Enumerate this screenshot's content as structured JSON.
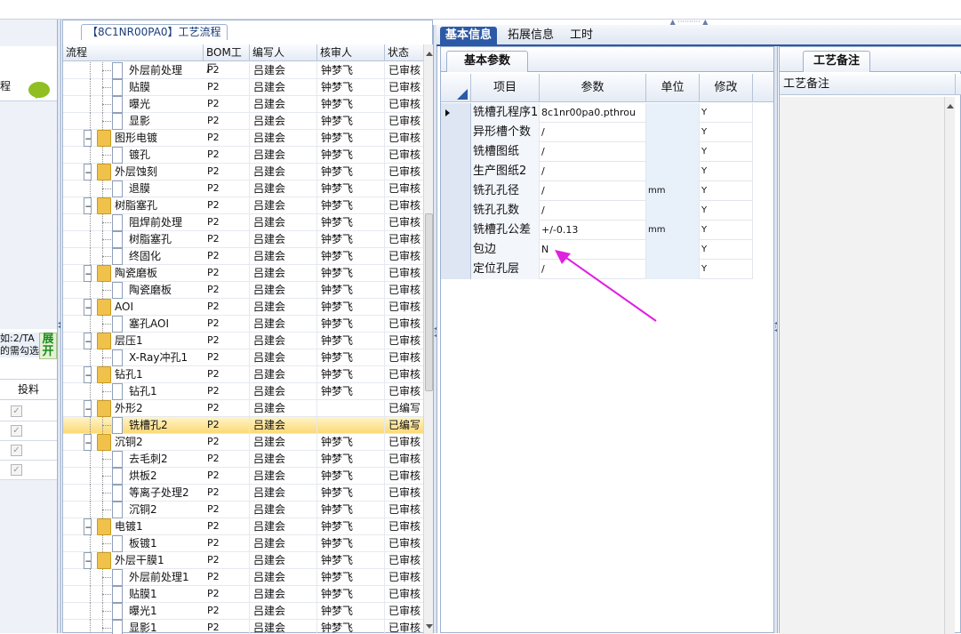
{
  "left_panel": {
    "title_fragment": "程",
    "hint_text": "如:2/TA 的需勾选",
    "expand_label": "展开",
    "column_label": "投料",
    "checked_rows": [
      "✓",
      "✓",
      "✓",
      "✓"
    ]
  },
  "flow_panel": {
    "caption": "【8C1NR00PA0】工艺流程",
    "columns": [
      "流程",
      "BOM工厂",
      "编写人",
      "核审人",
      "状态"
    ],
    "rows": [
      {
        "name": "外层前处理",
        "level": 2,
        "bom": "P2",
        "writer": "吕建会",
        "reviewer": "钟梦飞",
        "status": "已审核"
      },
      {
        "name": "贴膜",
        "level": 2,
        "bom": "P2",
        "writer": "吕建会",
        "reviewer": "钟梦飞",
        "status": "已审核"
      },
      {
        "name": "曝光",
        "level": 2,
        "bom": "P2",
        "writer": "吕建会",
        "reviewer": "钟梦飞",
        "status": "已审核"
      },
      {
        "name": "显影",
        "level": 2,
        "bom": "P2",
        "writer": "吕建会",
        "reviewer": "钟梦飞",
        "status": "已审核"
      },
      {
        "name": "图形电镀",
        "level": 1,
        "bom": "P2",
        "writer": "吕建会",
        "reviewer": "钟梦飞",
        "status": "已审核"
      },
      {
        "name": "镀孔",
        "level": 2,
        "bom": "P2",
        "writer": "吕建会",
        "reviewer": "钟梦飞",
        "status": "已审核"
      },
      {
        "name": "外层蚀刻",
        "level": 1,
        "bom": "P2",
        "writer": "吕建会",
        "reviewer": "钟梦飞",
        "status": "已审核"
      },
      {
        "name": "退膜",
        "level": 2,
        "bom": "P2",
        "writer": "吕建会",
        "reviewer": "钟梦飞",
        "status": "已审核"
      },
      {
        "name": "树脂塞孔",
        "level": 1,
        "bom": "P2",
        "writer": "吕建会",
        "reviewer": "钟梦飞",
        "status": "已审核"
      },
      {
        "name": "阻焊前处理",
        "level": 2,
        "bom": "P2",
        "writer": "吕建会",
        "reviewer": "钟梦飞",
        "status": "已审核"
      },
      {
        "name": "树脂塞孔",
        "level": 2,
        "bom": "P2",
        "writer": "吕建会",
        "reviewer": "钟梦飞",
        "status": "已审核"
      },
      {
        "name": "终固化",
        "level": 2,
        "bom": "P2",
        "writer": "吕建会",
        "reviewer": "钟梦飞",
        "status": "已审核"
      },
      {
        "name": "陶瓷磨板",
        "level": 1,
        "bom": "P2",
        "writer": "吕建会",
        "reviewer": "钟梦飞",
        "status": "已审核"
      },
      {
        "name": "陶瓷磨板",
        "level": 2,
        "bom": "P2",
        "writer": "吕建会",
        "reviewer": "钟梦飞",
        "status": "已审核"
      },
      {
        "name": "AOI",
        "level": 1,
        "bom": "P2",
        "writer": "吕建会",
        "reviewer": "钟梦飞",
        "status": "已审核"
      },
      {
        "name": "塞孔AOI",
        "level": 2,
        "bom": "P2",
        "writer": "吕建会",
        "reviewer": "钟梦飞",
        "status": "已审核"
      },
      {
        "name": "层压1",
        "level": 1,
        "bom": "P2",
        "writer": "吕建会",
        "reviewer": "钟梦飞",
        "status": "已审核"
      },
      {
        "name": "X-Ray冲孔1",
        "level": 2,
        "bom": "P2",
        "writer": "吕建会",
        "reviewer": "钟梦飞",
        "status": "已审核"
      },
      {
        "name": "钻孔1",
        "level": 1,
        "bom": "P2",
        "writer": "吕建会",
        "reviewer": "钟梦飞",
        "status": "已审核"
      },
      {
        "name": "钻孔1",
        "level": 2,
        "bom": "P2",
        "writer": "吕建会",
        "reviewer": "钟梦飞",
        "status": "已审核"
      },
      {
        "name": "外形2",
        "level": 1,
        "bom": "P2",
        "writer": "吕建会",
        "reviewer": "",
        "status": "已编写"
      },
      {
        "name": "铣槽孔2",
        "level": 2,
        "bom": "P2",
        "writer": "吕建会",
        "reviewer": "",
        "status": "已编写",
        "selected": true
      },
      {
        "name": "沉铜2",
        "level": 1,
        "bom": "P2",
        "writer": "吕建会",
        "reviewer": "钟梦飞",
        "status": "已审核"
      },
      {
        "name": "去毛刺2",
        "level": 2,
        "bom": "P2",
        "writer": "吕建会",
        "reviewer": "钟梦飞",
        "status": "已审核"
      },
      {
        "name": "烘板2",
        "level": 2,
        "bom": "P2",
        "writer": "吕建会",
        "reviewer": "钟梦飞",
        "status": "已审核"
      },
      {
        "name": "等离子处理2",
        "level": 2,
        "bom": "P2",
        "writer": "吕建会",
        "reviewer": "钟梦飞",
        "status": "已审核"
      },
      {
        "name": "沉铜2",
        "level": 2,
        "bom": "P2",
        "writer": "吕建会",
        "reviewer": "钟梦飞",
        "status": "已审核"
      },
      {
        "name": "电镀1",
        "level": 1,
        "bom": "P2",
        "writer": "吕建会",
        "reviewer": "钟梦飞",
        "status": "已审核"
      },
      {
        "name": "板镀1",
        "level": 2,
        "bom": "P2",
        "writer": "吕建会",
        "reviewer": "钟梦飞",
        "status": "已审核"
      },
      {
        "name": "外层干膜1",
        "level": 1,
        "bom": "P2",
        "writer": "吕建会",
        "reviewer": "钟梦飞",
        "status": "已审核"
      },
      {
        "name": "外层前处理1",
        "level": 2,
        "bom": "P2",
        "writer": "吕建会",
        "reviewer": "钟梦飞",
        "status": "已审核"
      },
      {
        "name": "贴膜1",
        "level": 2,
        "bom": "P2",
        "writer": "吕建会",
        "reviewer": "钟梦飞",
        "status": "已审核"
      },
      {
        "name": "曝光1",
        "level": 2,
        "bom": "P2",
        "writer": "吕建会",
        "reviewer": "钟梦飞",
        "status": "已审核"
      },
      {
        "name": "显影1",
        "level": 2,
        "bom": "P2",
        "writer": "吕建会",
        "reviewer": "钟梦飞",
        "status": "已审核"
      }
    ]
  },
  "tabs": [
    "基本信息",
    "拓展信息",
    "工时"
  ],
  "params_panel": {
    "subtab": "基本参数",
    "columns": [
      "项目",
      "参数",
      "单位",
      "修改"
    ],
    "rows": [
      {
        "name": "铣槽孔程序1",
        "value": "8c1nr00pa0.pthrou",
        "unit": "",
        "modify": "Y",
        "current": true
      },
      {
        "name": "异形槽个数",
        "value": "/",
        "unit": "",
        "modify": "Y"
      },
      {
        "name": "铣槽图纸",
        "value": "/",
        "unit": "",
        "modify": "Y"
      },
      {
        "name": "生产图纸2",
        "value": "/",
        "unit": "",
        "modify": "Y"
      },
      {
        "name": "铣孔孔径",
        "value": "/",
        "unit": "mm",
        "modify": "Y"
      },
      {
        "name": "铣孔孔数",
        "value": "/",
        "unit": "",
        "modify": "Y"
      },
      {
        "name": "铣槽孔公差",
        "value": "+/-0.13",
        "unit": "mm",
        "modify": "Y"
      },
      {
        "name": "包边",
        "value": "N",
        "unit": "",
        "modify": "Y"
      },
      {
        "name": "定位孔层",
        "value": "/",
        "unit": "",
        "modify": "Y"
      }
    ],
    "annotation_color": "#e020e0"
  },
  "notes_panel": {
    "subtab": "工艺备注",
    "column": "工艺备注"
  }
}
